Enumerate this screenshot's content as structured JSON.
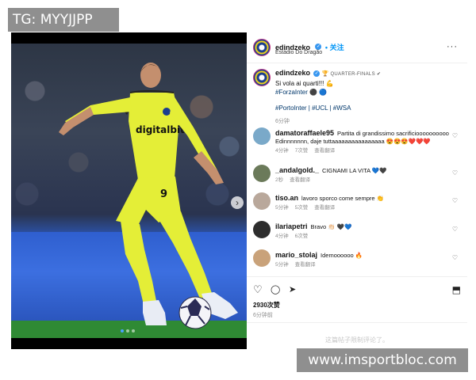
{
  "watermarks": {
    "top": "TG: MYYJJPP",
    "bottom": "www.imsportbloc.com"
  },
  "post": {
    "author": "edindzeko",
    "follow_label": "• 关注",
    "location": "Estádio Do Dragão",
    "more_label": "···",
    "caption": {
      "badge": "QUARTER-FINALS ✔",
      "line1": "Si vola ai quarti!!! 💪",
      "line2": "#ForzaInter ⚫ 🔵",
      "hashtags": "#PortoInter | #UCL | #WSA",
      "age": "6分钟"
    },
    "comments": [
      {
        "user": "damatoraffaele95",
        "text": "Partita di grandissimo sacrificioooooooooo Edinnnnnnn, daje tuttaaaaaaaaaaaaaaaa 😍😍😍❤️❤️❤️",
        "age": "4分钟",
        "likes": "7次赞",
        "reply": "查看翻译",
        "avatar_color": "#7aa9c9"
      },
      {
        "user": "_andalgold._",
        "text": "CIGNAMI LA VITA 💙🖤",
        "age": "2秒",
        "likes": "",
        "reply": "查看翻译",
        "avatar_color": "#6b7a5a"
      },
      {
        "user": "tiso.an",
        "text": "lavoro sporco come sempre 👏",
        "age": "5分钟",
        "likes": "5次赞",
        "reply": "查看翻译",
        "avatar_color": "#b9a89b"
      },
      {
        "user": "ilariapetri",
        "text": "Bravo 👏🏻 🖤💙",
        "age": "4分钟",
        "likes": "6次赞",
        "reply": "",
        "avatar_color": "#2d2d2d"
      },
      {
        "user": "mario_stolaj",
        "text": "Idemoooooo 🔥",
        "age": "5分钟",
        "likes": "",
        "reply": "查看翻译",
        "avatar_color": "#c9a27a"
      }
    ],
    "likes": "2930次赞",
    "time": "6分钟前",
    "comments_disabled": "这篇帖子限制评论了。"
  },
  "icons": {
    "heart": "♡",
    "comment": "◯",
    "share": "➤",
    "save": "⬒",
    "chevron": "›"
  },
  "colors": {
    "accent": "#0095f6",
    "verified": "#3897f0",
    "kit": "#e6f23a"
  },
  "carousel": {
    "count": 3,
    "active": 1
  }
}
